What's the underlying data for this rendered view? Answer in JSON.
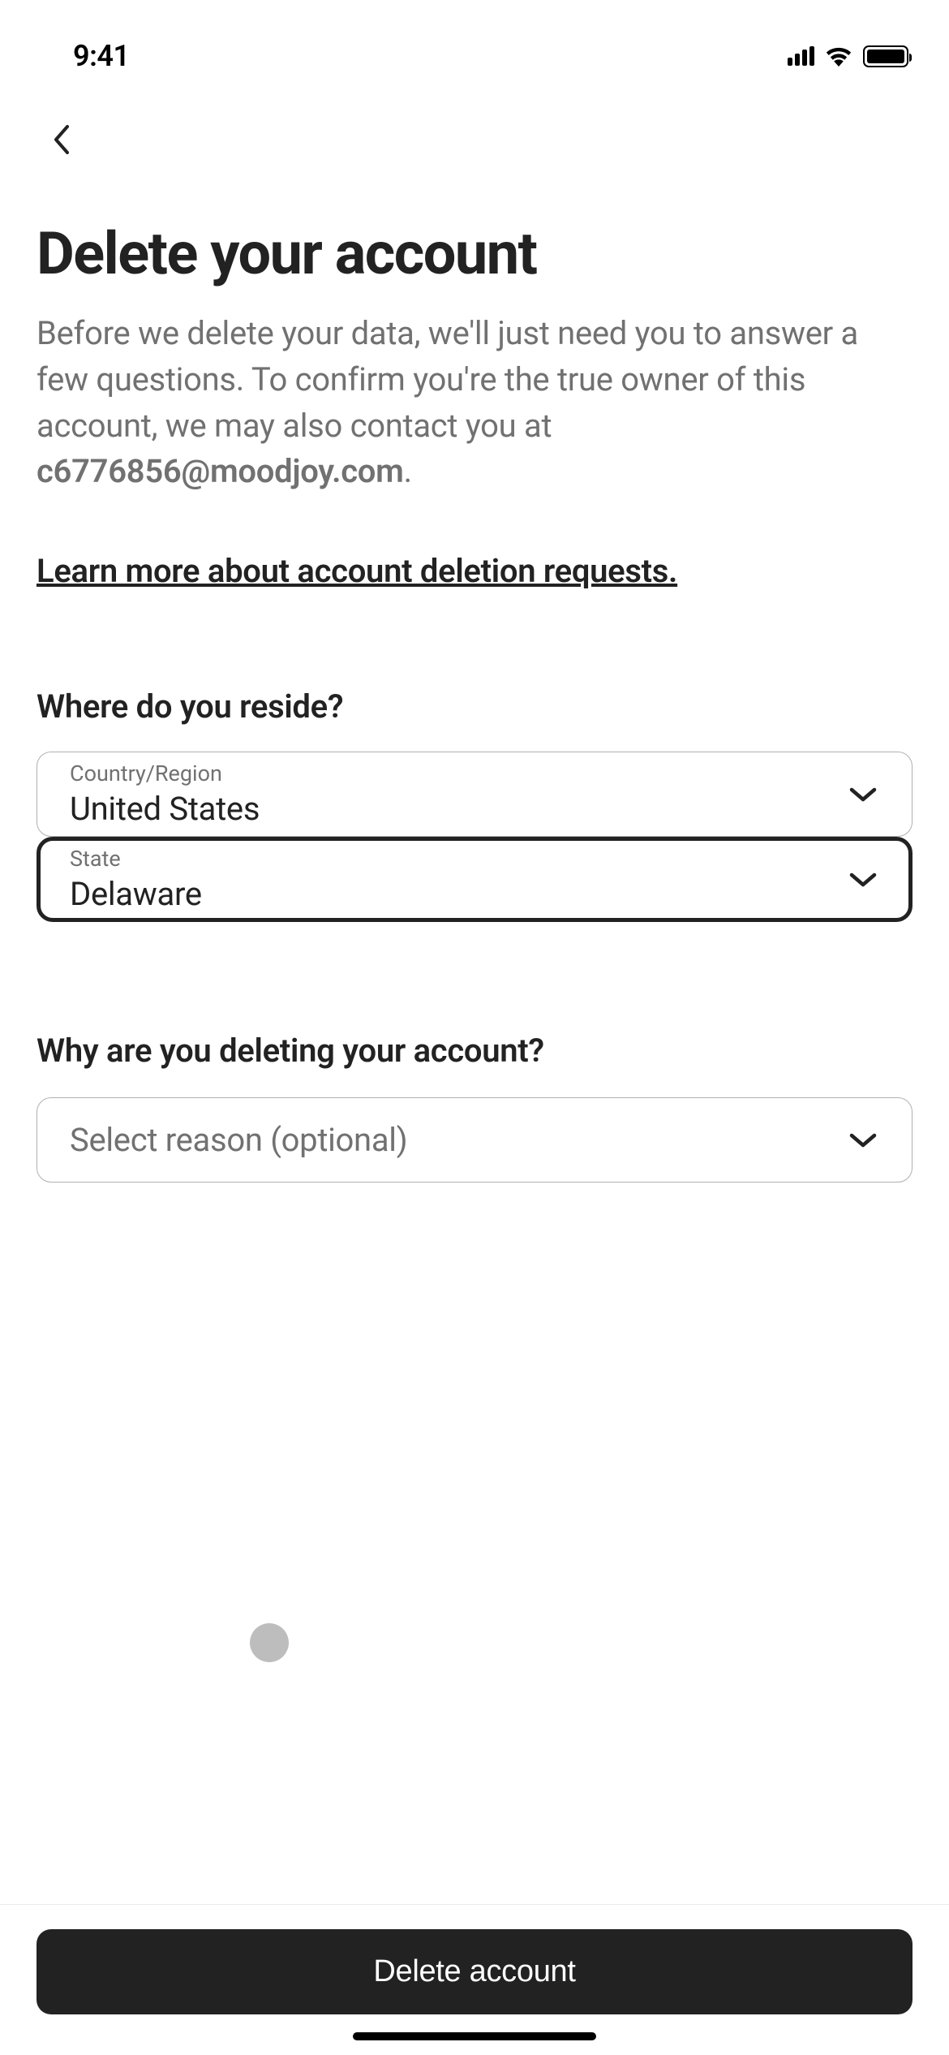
{
  "status_bar": {
    "time": "9:41"
  },
  "page": {
    "title": "Delete your account",
    "description_prefix": "Before we delete your data, we'll just need you to answer a few questions. To confirm you're the true owner of this account, we may also contact you at ",
    "email": "c6776856@moodjoy.com",
    "description_suffix": ".",
    "learn_more": "Learn more about account deletion requests."
  },
  "form": {
    "reside_question": "Where do you reside?",
    "country_label": "Country/Region",
    "country_value": "United States",
    "state_label": "State",
    "state_value": "Delaware",
    "reason_question": "Why are you deleting your account?",
    "reason_placeholder": "Select reason (optional)"
  },
  "footer": {
    "delete_button": "Delete account"
  }
}
